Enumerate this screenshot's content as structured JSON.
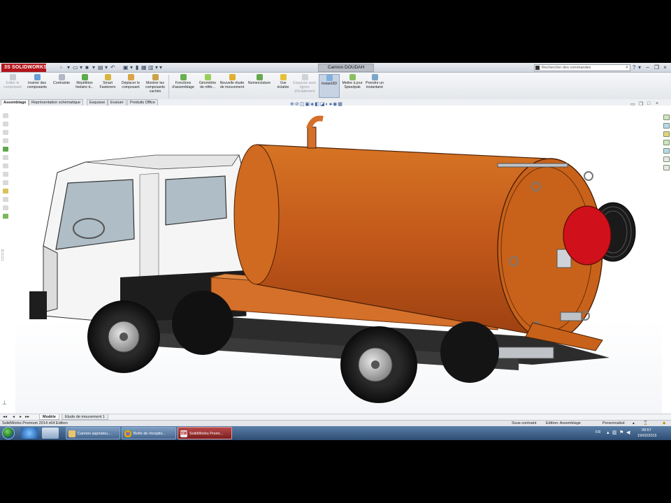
{
  "app": {
    "logo_text": "SOLIDWORKS",
    "document_title": "Camion DOUDAH",
    "search_placeholder": "Rechercher des commandes"
  },
  "ribbon": {
    "items": [
      {
        "label": "Editer le composant",
        "disabled": true
      },
      {
        "label": "Insérer des composants",
        "disabled": false
      },
      {
        "label": "Contrainte",
        "disabled": false
      },
      {
        "label": "Répétition linéaire d...",
        "disabled": false
      },
      {
        "label": "Smart Fasteners",
        "disabled": false
      },
      {
        "label": "Déplacer le composant",
        "disabled": false
      },
      {
        "label": "Montrer les composants cachés",
        "disabled": false
      },
      {
        "label": "Fonctions d'assemblage",
        "disabled": false
      },
      {
        "label": "Géométrie de référ...",
        "disabled": false
      },
      {
        "label": "Nouvelle étude de mouvement",
        "disabled": false
      },
      {
        "label": "Nomenclature",
        "disabled": false
      },
      {
        "label": "Vue éclatée",
        "disabled": false
      },
      {
        "label": "Esquisse avec lignes d'éclatement",
        "disabled": true
      },
      {
        "label": "Instant3D",
        "disabled": false
      },
      {
        "label": "Mettre à jour Speedpak",
        "disabled": false
      },
      {
        "label": "Prendre un instantané",
        "disabled": false
      }
    ]
  },
  "tabs": [
    "Assemblage",
    "Représentation schématique",
    "Esquisse",
    "Evaluer",
    "Produits Office"
  ],
  "model_tabs": [
    "Modèle",
    "Etude de mouvement 1"
  ],
  "status": {
    "edition": "SolidWorks Premium 2014 x64 Edition",
    "constraint": "Sous-contraint",
    "mode": "Edition: Assemblage",
    "custom": "Personnalisé"
  },
  "taskbar": {
    "tasks": [
      {
        "label": "Camion aspirateu...",
        "color": "#e9c46a"
      },
      {
        "label": "Boîte de réceptio...",
        "color": "#34a853"
      },
      {
        "label": "SolidWorks Premi...",
        "color": "#c1121f"
      }
    ],
    "language": "FR",
    "time": "09:57",
    "date": "19/02/2015"
  },
  "colors": {
    "tank": "#c8621a",
    "reel": "#d0101a",
    "cab": "#f4f4f4",
    "accent": "#b3161c"
  }
}
